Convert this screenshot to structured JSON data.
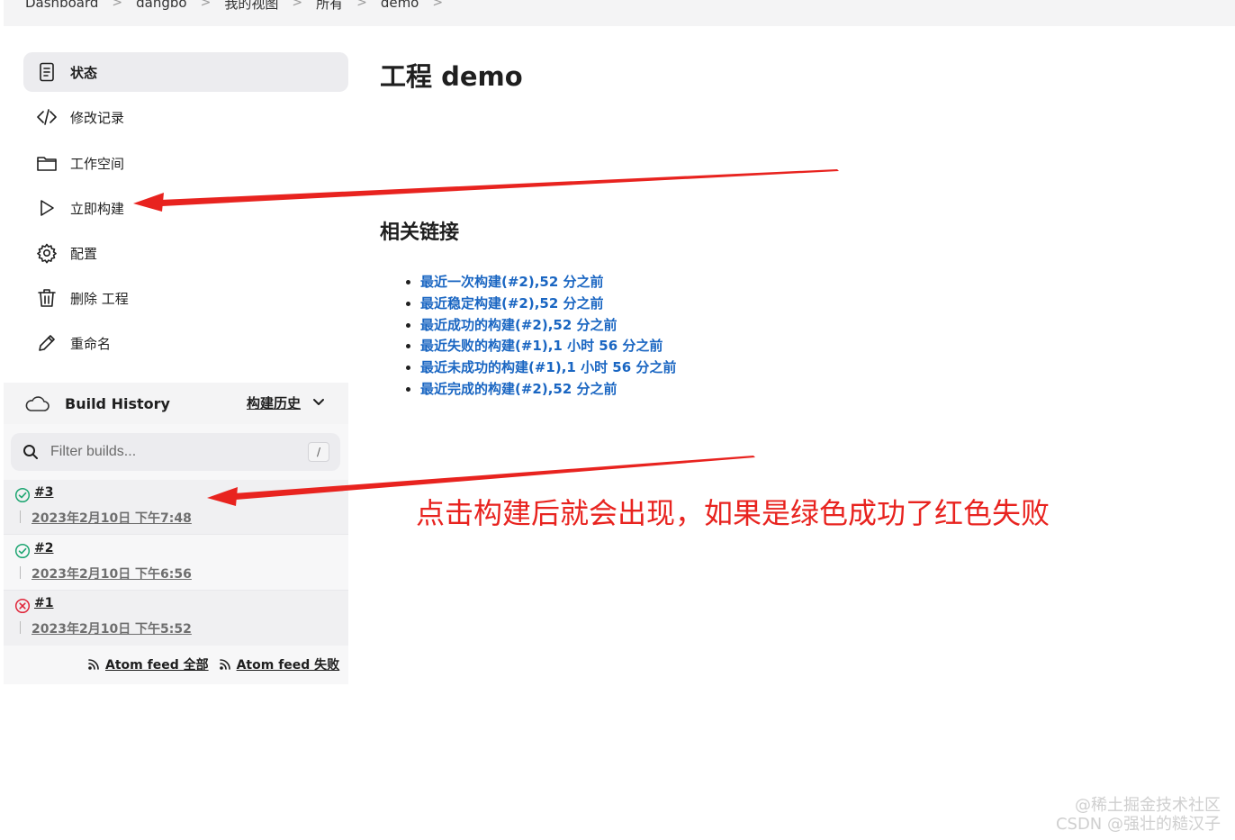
{
  "breadcrumb": [
    "Dashboard",
    "dangbo",
    "我的视图",
    "所有",
    "demo"
  ],
  "sidebar": {
    "tasks": [
      {
        "label": "状态",
        "icon": "document-icon"
      },
      {
        "label": "修改记录",
        "icon": "code-icon"
      },
      {
        "label": "工作空间",
        "icon": "folder-icon"
      },
      {
        "label": "立即构建",
        "icon": "play-icon"
      },
      {
        "label": "配置",
        "icon": "gear-icon"
      },
      {
        "label": "删除 工程",
        "icon": "trash-icon"
      },
      {
        "label": "重命名",
        "icon": "pencil-icon"
      }
    ]
  },
  "build_history": {
    "title": "Build History",
    "trend_label": "构建历史",
    "filter_placeholder": "Filter builds...",
    "filter_shortcut": "/",
    "builds": [
      {
        "number": "#3",
        "date": "2023年2月10日 下午7:48",
        "status": "success"
      },
      {
        "number": "#2",
        "date": "2023年2月10日 下午6:56",
        "status": "success"
      },
      {
        "number": "#1",
        "date": "2023年2月10日 下午5:52",
        "status": "failed"
      }
    ],
    "feeds": {
      "all": "Atom feed 全部",
      "failed": "Atom feed 失败"
    }
  },
  "main": {
    "title": "工程 demo",
    "related_title": "相关链接",
    "links": [
      "最近一次构建(#2),52 分之前",
      "最近稳定构建(#2),52 分之前",
      "最近成功的构建(#2),52 分之前",
      "最近失败的构建(#1),1 小时 56 分之前",
      "最近未成功的构建(#1),1 小时 56 分之前",
      "最近完成的构建(#2),52 分之前"
    ]
  },
  "annotation": {
    "text": "点击构建后就会出现，如果是绿色成功了红色失败",
    "color": "#e8231f"
  },
  "watermark": {
    "line1": "@稀土掘金技术社区",
    "line2": "CSDN @强壮的糙汉子"
  },
  "colors": {
    "link": "#1a66c2",
    "success": "#1ea672",
    "failed": "#e0263a"
  }
}
